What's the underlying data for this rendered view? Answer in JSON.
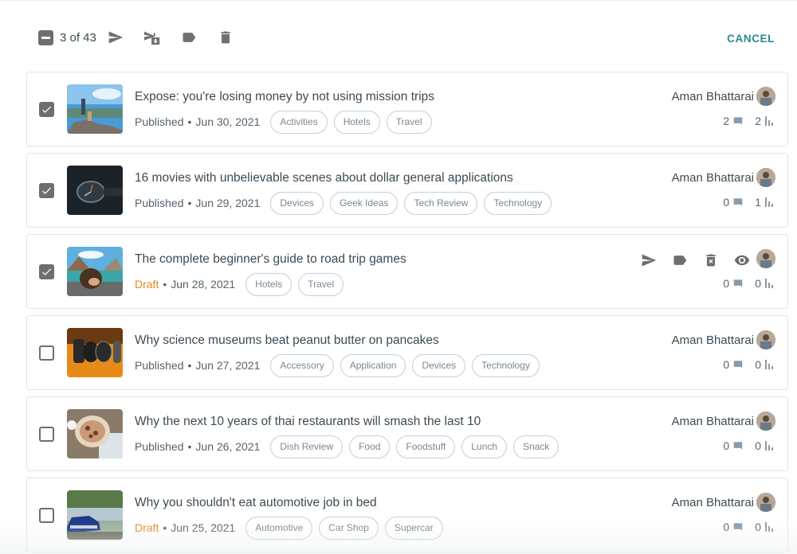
{
  "toolbar": {
    "selection_count": "3 of 43",
    "cancel_label": "CANCEL",
    "icons": [
      "bulk-select-indeterminate",
      "publish-send-icon",
      "move-to-drafts-icon",
      "label-tag-icon",
      "delete-trash-icon"
    ]
  },
  "colors": {
    "accent": "#2a8a96",
    "draft": "#e8852a",
    "text": "#3d4a53",
    "icon": "#6e6e6e"
  },
  "posts": [
    {
      "checked": true,
      "title": "Expose: you're losing money by not using mission trips",
      "status": "Published",
      "date": "Jun 30, 2021",
      "tags": [
        "Activities",
        "Hotels",
        "Travel"
      ],
      "author": "Aman Bhattarai",
      "comments": "2",
      "views": "2",
      "thumb": "mountain-hikers"
    },
    {
      "checked": true,
      "title": "16 movies with unbelievable scenes about dollar general applications",
      "status": "Published",
      "date": "Jun 29, 2021",
      "tags": [
        "Devices",
        "Geek Ideas",
        "Tech Review",
        "Technology"
      ],
      "author": "Aman Bhattarai",
      "comments": "0",
      "views": "1",
      "thumb": "watch"
    },
    {
      "checked": true,
      "hovered": true,
      "title": "The complete beginner's guide to road trip games",
      "status": "Draft",
      "date": "Jun 28, 2021",
      "tags": [
        "Hotels",
        "Travel"
      ],
      "author": "",
      "comments": "0",
      "views": "0",
      "thumb": "lake-woman",
      "row_actions": [
        "send-icon",
        "label-icon",
        "delete-icon",
        "preview-eye-icon"
      ]
    },
    {
      "checked": false,
      "title": "Why science museums beat peanut butter on pancakes",
      "status": "Published",
      "date": "Jun 27, 2021",
      "tags": [
        "Accessory",
        "Application",
        "Devices",
        "Technology"
      ],
      "author": "Aman Bhattarai",
      "comments": "0",
      "views": "0",
      "thumb": "smartwatches"
    },
    {
      "checked": false,
      "title": "Why the next 10 years of thai restaurants will smash the last 10",
      "status": "Published",
      "date": "Jun 26, 2021",
      "tags": [
        "Dish Review",
        "Food",
        "Foodstuff",
        "Lunch",
        "Snack"
      ],
      "author": "Aman Bhattarai",
      "comments": "0",
      "views": "0",
      "thumb": "pizza"
    },
    {
      "checked": false,
      "title": "Why you shouldn't eat automotive job in bed",
      "status": "Draft",
      "date": "Jun 25, 2021",
      "tags": [
        "Automotive",
        "Car Shop",
        "Supercar"
      ],
      "author": "Aman Bhattarai",
      "comments": "0",
      "views": "0",
      "thumb": "blue-car"
    }
  ]
}
